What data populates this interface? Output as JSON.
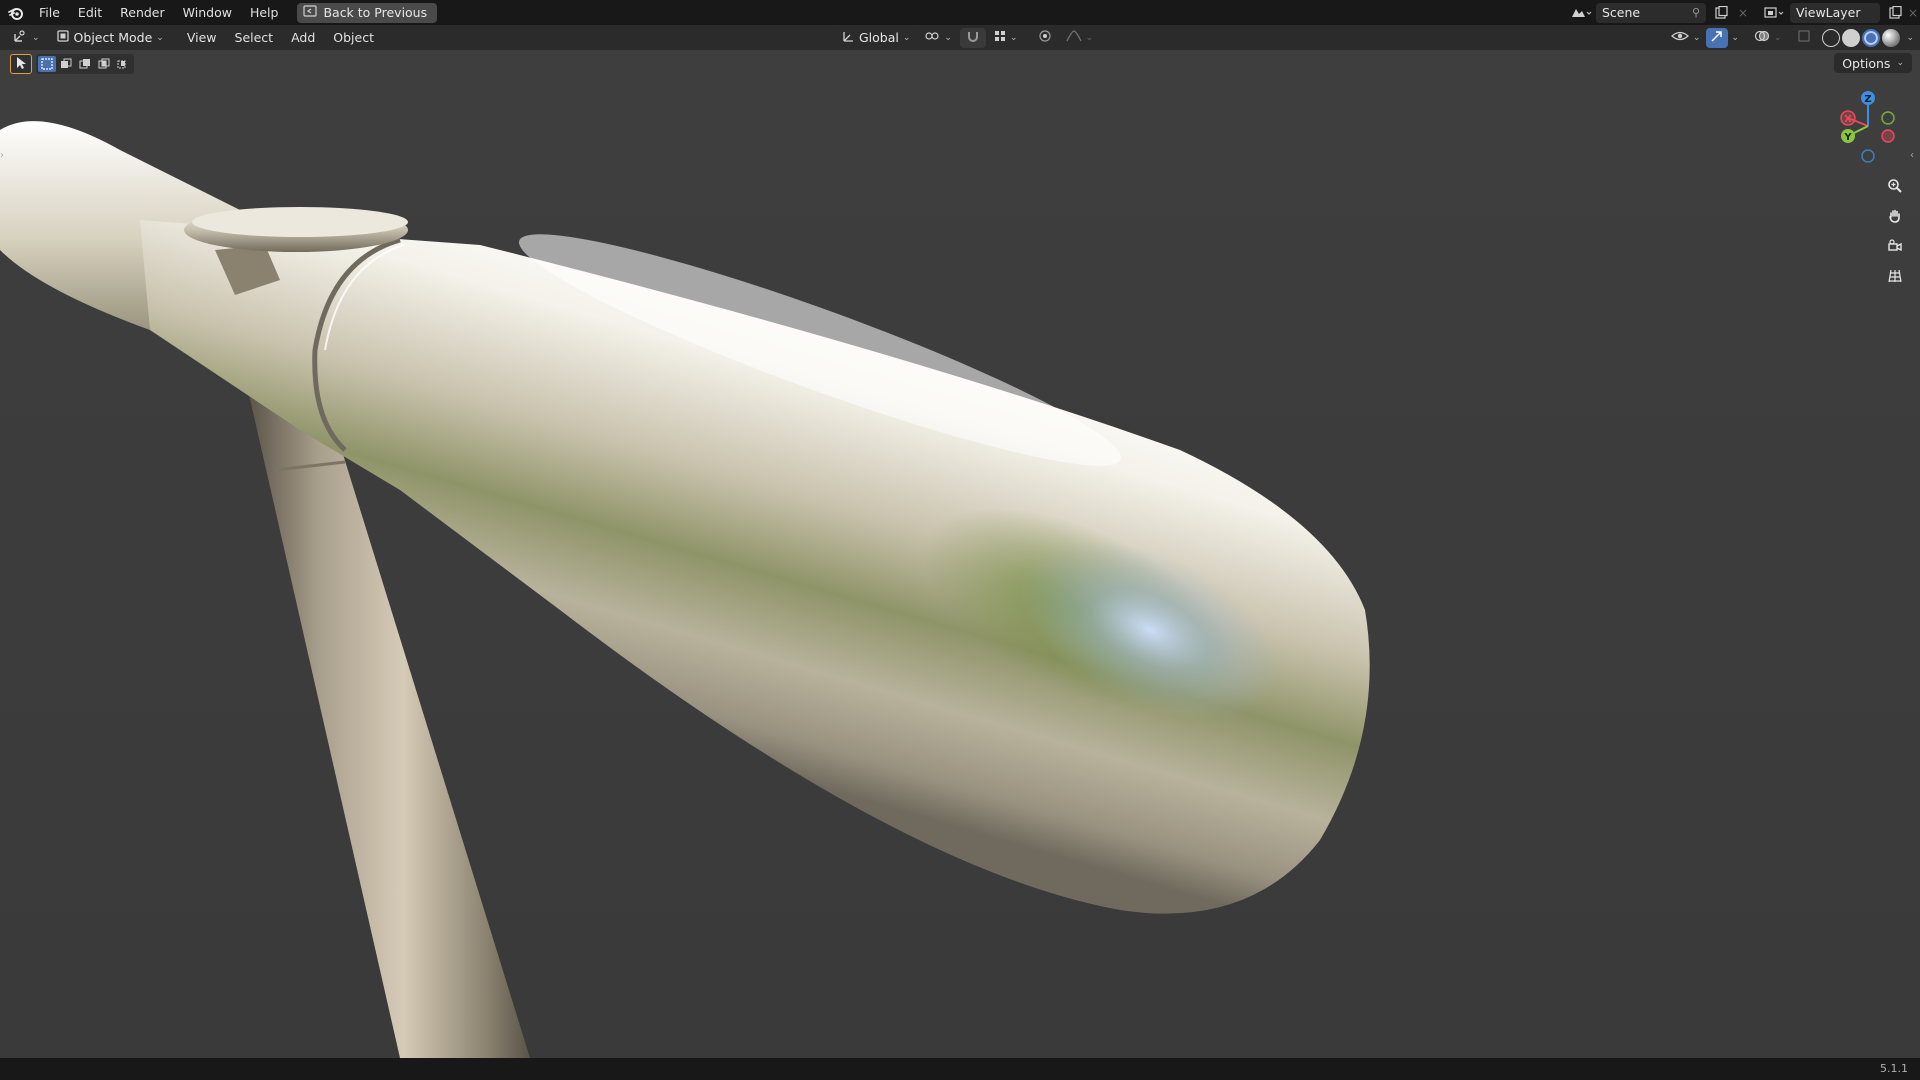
{
  "topbar": {
    "menus": [
      "File",
      "Edit",
      "Render",
      "Window",
      "Help"
    ],
    "back_label": "Back to Previous",
    "scene_name": "Scene",
    "view_layer_name": "ViewLayer"
  },
  "header": {
    "mode_label": "Object Mode",
    "menus": [
      "View",
      "Select",
      "Add",
      "Object"
    ],
    "orientation_label": "Global"
  },
  "viewport": {
    "options_label": "Options",
    "gizmo_axes": {
      "x": "X",
      "y": "Y",
      "z": "Z"
    }
  },
  "status": {
    "version": "5.1.1"
  },
  "colors": {
    "topbar_bg": "#181818",
    "header_bg": "#2b2b2b",
    "viewport_bg": "#3d3d3d",
    "axis_x": "#e84a5a",
    "axis_y": "#8cc63f",
    "axis_z": "#3d8fe0",
    "accent_blue": "#4772b3"
  }
}
